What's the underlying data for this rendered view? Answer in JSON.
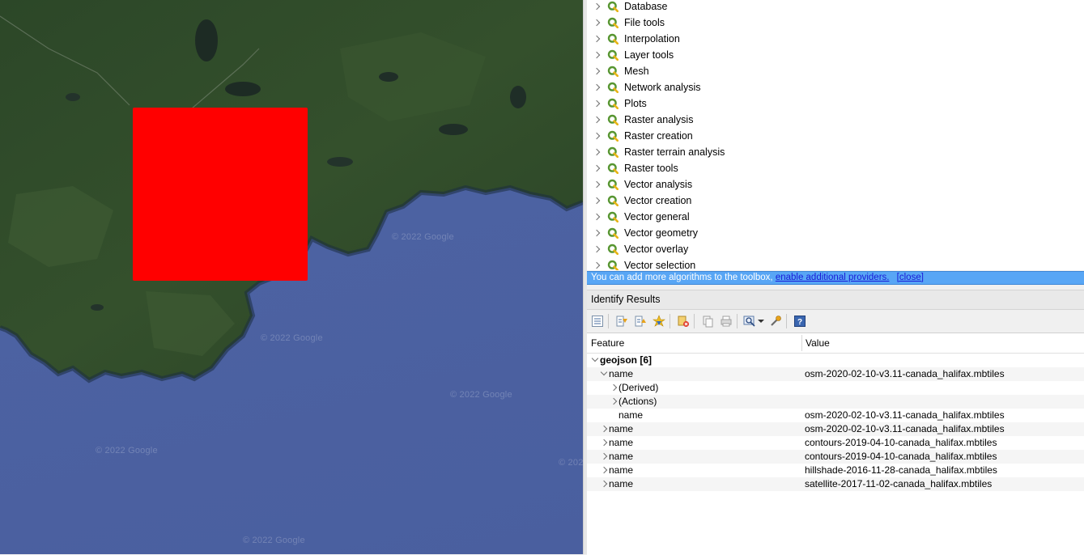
{
  "map": {
    "watermark_text": "© 2022 Google",
    "overlay_color": "#ff0000",
    "water_color": "#4c62a2",
    "land_color": "#2f4a2a"
  },
  "toolbox": {
    "items": [
      {
        "label": "Database"
      },
      {
        "label": "File tools"
      },
      {
        "label": "Interpolation"
      },
      {
        "label": "Layer tools"
      },
      {
        "label": "Mesh"
      },
      {
        "label": "Network analysis"
      },
      {
        "label": "Plots"
      },
      {
        "label": "Raster analysis"
      },
      {
        "label": "Raster creation"
      },
      {
        "label": "Raster terrain analysis"
      },
      {
        "label": "Raster tools"
      },
      {
        "label": "Vector analysis"
      },
      {
        "label": "Vector creation"
      },
      {
        "label": "Vector general"
      },
      {
        "label": "Vector geometry"
      },
      {
        "label": "Vector overlay"
      },
      {
        "label": "Vector selection"
      }
    ],
    "icon": "qgis-q-icon",
    "icon_color": "#589632"
  },
  "infobar": {
    "text": "You can add more algorithms to the toolbox,",
    "link_label": "enable additional providers.",
    "close_label": "[close]",
    "bg_color": "#58a6f5"
  },
  "identify": {
    "title": "Identify Results",
    "columns": {
      "feature": "Feature",
      "value": "Value"
    },
    "rows": [
      {
        "feature": "geojson  [6]",
        "value": "",
        "expander": "down",
        "level": 0,
        "bold": true
      },
      {
        "feature": "name",
        "value": "osm-2020-02-10-v3.11-canada_halifax.mbtiles",
        "expander": "down",
        "level": 1
      },
      {
        "feature": "(Derived)",
        "value": "",
        "expander": "right",
        "level": 2
      },
      {
        "feature": "(Actions)",
        "value": "",
        "expander": "right",
        "level": 2
      },
      {
        "feature": "name",
        "value": "osm-2020-02-10-v3.11-canada_halifax.mbtiles",
        "expander": "none",
        "level": 2
      },
      {
        "feature": "name",
        "value": "osm-2020-02-10-v3.11-canada_halifax.mbtiles",
        "expander": "right",
        "level": 1
      },
      {
        "feature": "name",
        "value": "contours-2019-04-10-canada_halifax.mbtiles",
        "expander": "right",
        "level": 1
      },
      {
        "feature": "name",
        "value": "contours-2019-04-10-canada_halifax.mbtiles",
        "expander": "right",
        "level": 1
      },
      {
        "feature": "name",
        "value": "hillshade-2016-11-28-canada_halifax.mbtiles",
        "expander": "right",
        "level": 1
      },
      {
        "feature": "name",
        "value": "satellite-2017-11-02-canada_halifax.mbtiles",
        "expander": "right",
        "level": 1
      }
    ]
  }
}
